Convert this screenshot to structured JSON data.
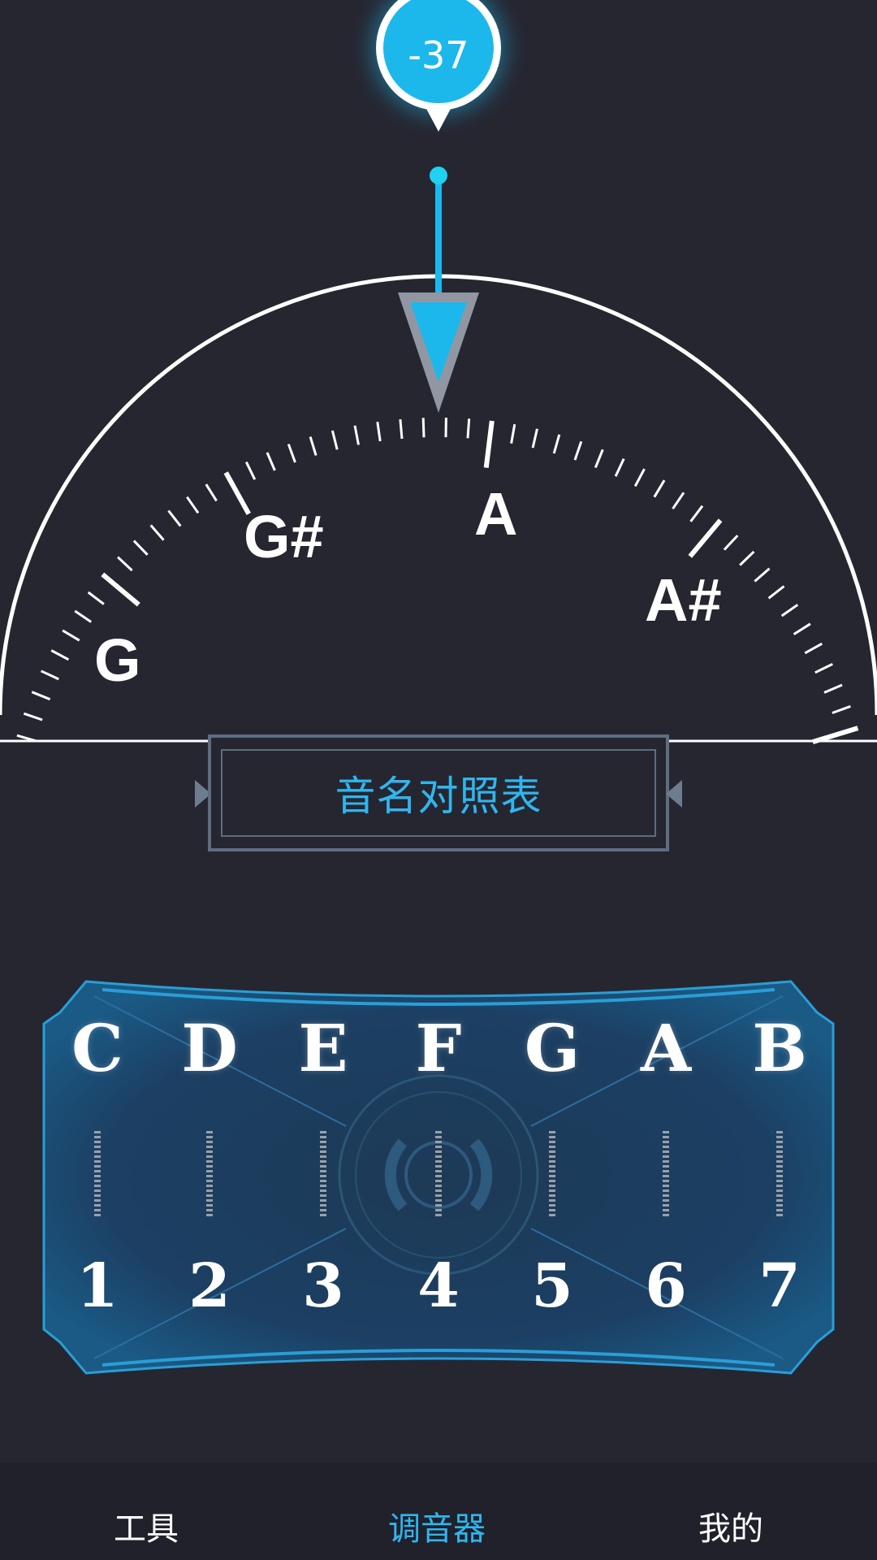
{
  "tuner": {
    "cents_value": "-37",
    "dial_notes": [
      "G",
      "G#",
      "A",
      "A#"
    ]
  },
  "reference_button": {
    "label": "音名对照表"
  },
  "note_table": {
    "letters": [
      "C",
      "D",
      "E",
      "F",
      "G",
      "A",
      "B"
    ],
    "numbers": [
      "1",
      "2",
      "3",
      "4",
      "5",
      "6",
      "7"
    ]
  },
  "bottom_nav": {
    "items": [
      {
        "label": "工具",
        "active": false
      },
      {
        "label": "调音器",
        "active": true
      },
      {
        "label": "我的",
        "active": false
      }
    ]
  },
  "colors": {
    "background": "#262631",
    "accent": "#1cb8ec",
    "panel_glow": "#2fd8ff",
    "divider": "#ffffff"
  }
}
